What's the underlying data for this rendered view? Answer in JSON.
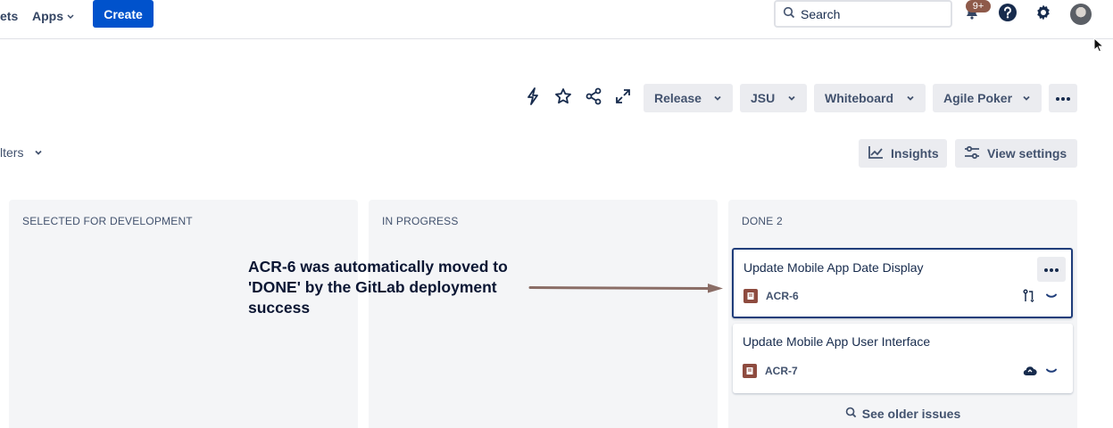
{
  "nav": {
    "partial_item": "ets",
    "apps_label": "Apps",
    "create_label": "Create",
    "search_placeholder": "Search",
    "notifications_badge": "9+"
  },
  "toolbar": {
    "release_label": "Release",
    "jsu_label": "JSU",
    "whiteboard_label": "Whiteboard",
    "agile_poker_label": "Agile Poker",
    "filters_label": "lters",
    "insights_label": "Insights",
    "view_settings_label": "View settings"
  },
  "board": {
    "columns": [
      {
        "title": "SELECTED FOR DEVELOPMENT"
      },
      {
        "title": "IN PROGRESS"
      },
      {
        "title": "DONE 2"
      }
    ],
    "cards": [
      {
        "title": "Update Mobile App Date Display",
        "key": "ACR-6"
      },
      {
        "title": "Update Mobile App User Interface",
        "key": "ACR-7"
      }
    ],
    "see_older_label": "See older issues"
  },
  "annotation": {
    "text": "ACR-6 was automatically moved to 'DONE' by the GitLab deployment success"
  },
  "colors": {
    "primary": "#0052cc",
    "column_bg": "#f4f5f7",
    "button_bg": "#ebecf0",
    "selected_border": "#1f3d7a",
    "issue_type": "#8e4b3f",
    "annotation_arrow": "#8a6d66"
  }
}
